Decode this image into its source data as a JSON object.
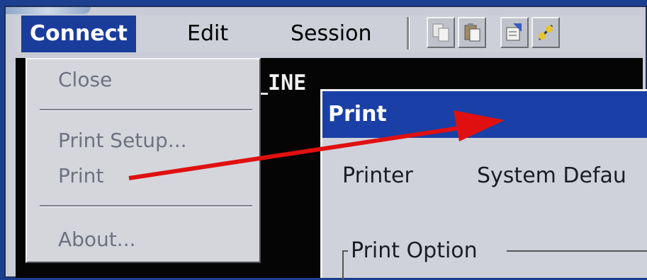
{
  "menubar": {
    "connect_label": "Connect",
    "edit_label": "Edit",
    "session_label": "Session"
  },
  "toolbar": {
    "buttons": [
      "copy-icon",
      "paste-icon",
      "properties-icon",
      "connect-icon"
    ]
  },
  "terminal": {
    "visible_text": "_INE"
  },
  "connect_menu": {
    "items": [
      "Close",
      "Print Setup...",
      "Print",
      "About..."
    ]
  },
  "print_dialog": {
    "title": "Print",
    "printer_label": "Printer",
    "printer_value": "System Defau",
    "print_option_group": "Print Option"
  },
  "colors": {
    "menu_highlight": "#1a3d9c",
    "title_bar": "#1a3fa6",
    "annotation_arrow": "#e01010"
  }
}
